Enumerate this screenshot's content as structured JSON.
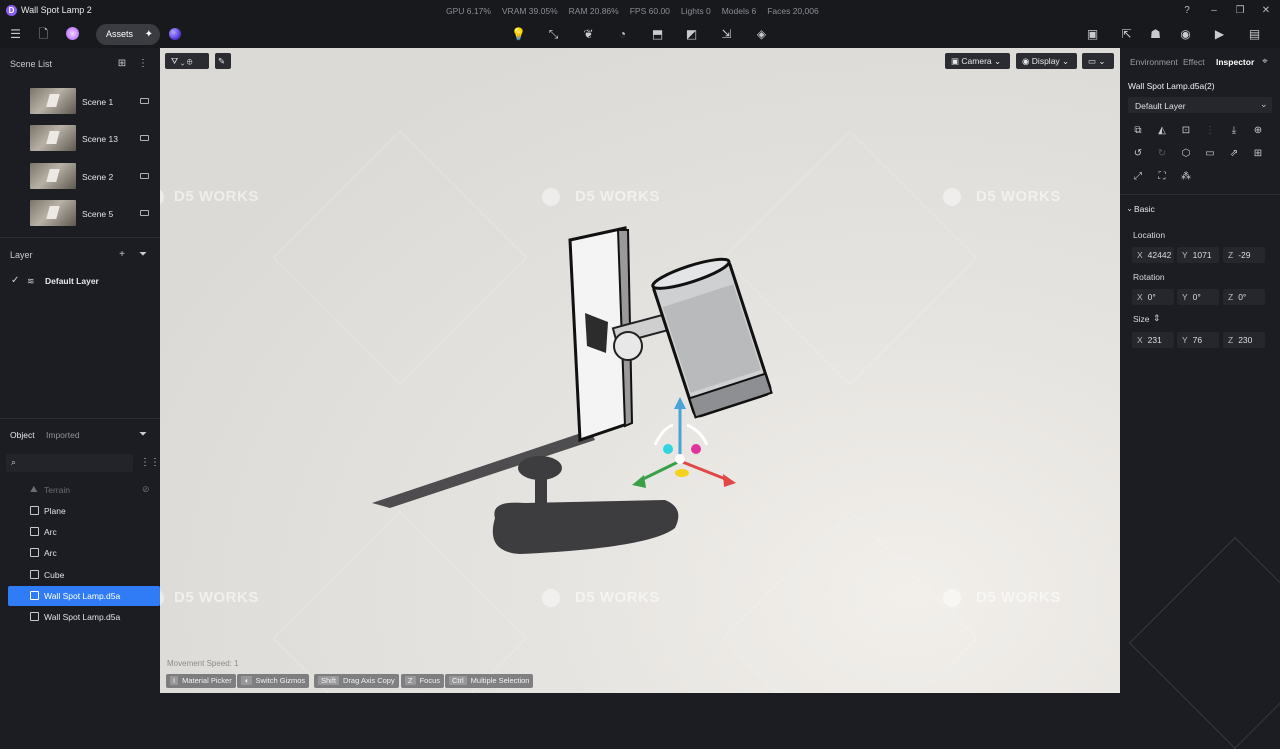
{
  "window": {
    "title": "Wall Spot Lamp 2",
    "logo": "D"
  },
  "stats": [
    "GPU 6.17%",
    "VRAM 39.05%",
    "RAM 20.86%",
    "FPS 60.00",
    "Lights 0",
    "Models 6",
    "Faces 20,006"
  ],
  "toolbar": {
    "assets_label": "Assets"
  },
  "scene_list": {
    "title": "Scene List",
    "scenes": [
      {
        "label": "Scene 1"
      },
      {
        "label": "Scene 13"
      },
      {
        "label": "Scene 2"
      },
      {
        "label": "Scene 5"
      }
    ]
  },
  "layer": {
    "title": "Layer",
    "items": [
      {
        "label": "Default Layer"
      }
    ]
  },
  "objects": {
    "tabs": [
      "Object",
      "Imported"
    ],
    "items": [
      {
        "label": "Terrain"
      },
      {
        "label": "Plane"
      },
      {
        "label": "Arc"
      },
      {
        "label": "Arc"
      },
      {
        "label": "Cube"
      },
      {
        "label": "Wall Spot Lamp.d5a"
      },
      {
        "label": "Wall Spot Lamp.d5a"
      }
    ]
  },
  "viewport": {
    "camera_label": "Camera",
    "display_label": "Display",
    "watermark": "D5 WORKS",
    "movement_speed": "Movement Speed: 1",
    "hints": [
      {
        "key": "I",
        "label": "Material Picker"
      },
      {
        "key": "",
        "label": "Switch Gizmos"
      },
      {
        "key": "Shift",
        "label": "Drag Axis Copy"
      },
      {
        "key": "Z",
        "label": "Focus"
      },
      {
        "key": "Ctrl",
        "label": "Multiple Selection"
      }
    ]
  },
  "inspector": {
    "tabs": [
      "Environment",
      "Effect",
      "Inspector"
    ],
    "object_name": "Wall Spot Lamp.d5a(2)",
    "layer_select": "Default Layer",
    "basic_label": "Basic",
    "location_label": "Location",
    "location": [
      {
        "axis": "X",
        "value": "42442"
      },
      {
        "axis": "Y",
        "value": "1071"
      },
      {
        "axis": "Z",
        "value": "-29"
      }
    ],
    "rotation_label": "Rotation",
    "rotation": [
      {
        "axis": "X",
        "value": "0°"
      },
      {
        "axis": "Y",
        "value": "0°"
      },
      {
        "axis": "Z",
        "value": "0°"
      }
    ],
    "size_label": "Size",
    "size": [
      {
        "axis": "X",
        "value": "231"
      },
      {
        "axis": "Y",
        "value": "76"
      },
      {
        "axis": "Z",
        "value": "230"
      }
    ]
  },
  "colors": {
    "accent": "#2f7cf6",
    "panel": "#1b1d22",
    "viewport": "#dedcd8",
    "gizmo_y": "#4aa3d8",
    "gizmo_x": "#e04848",
    "gizmo_z": "#3aa048"
  }
}
